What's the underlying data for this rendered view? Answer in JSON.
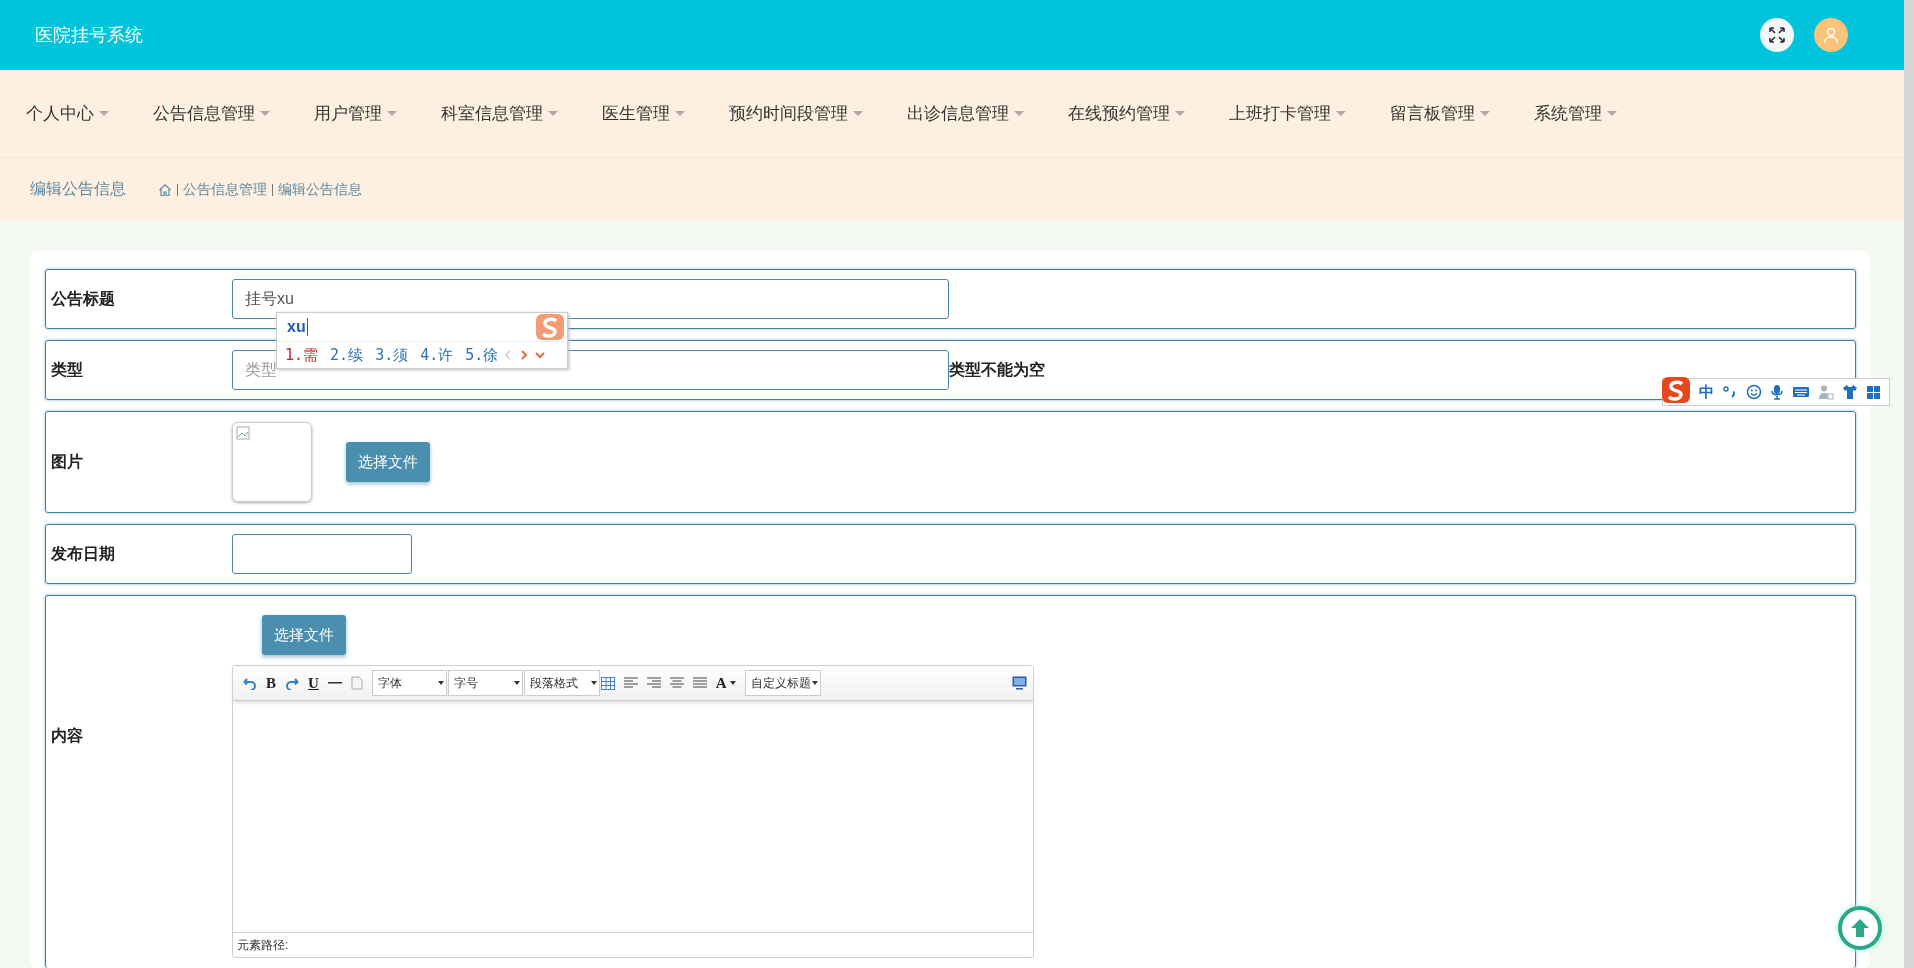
{
  "header": {
    "title": "医院挂号系统"
  },
  "nav": [
    {
      "label": "个人中心"
    },
    {
      "label": "公告信息管理"
    },
    {
      "label": "用户管理"
    },
    {
      "label": "科室信息管理"
    },
    {
      "label": "医生管理"
    },
    {
      "label": "预约时间段管理"
    },
    {
      "label": "出诊信息管理"
    },
    {
      "label": "在线预约管理"
    },
    {
      "label": "上班打卡管理"
    },
    {
      "label": "留言板管理"
    },
    {
      "label": "系统管理"
    }
  ],
  "breadcrumb": {
    "page_title": "编辑公告信息",
    "path": [
      "公告信息管理",
      "编辑公告信息"
    ]
  },
  "form": {
    "fields": [
      {
        "kind": "text",
        "label": "公告标题",
        "value": "挂号xu"
      },
      {
        "kind": "text",
        "label": "类型",
        "placeholder": "类型",
        "error": "类型不能为空"
      },
      {
        "kind": "image",
        "label": "图片",
        "button": "选择文件"
      },
      {
        "kind": "date",
        "label": "发布日期"
      },
      {
        "kind": "editor",
        "label": "内容",
        "button": "选择文件"
      }
    ]
  },
  "editor": {
    "bold": "B",
    "underline": "U",
    "font_color": "A",
    "selects": [
      "字体",
      "字号",
      "段落格式",
      "自定义标题"
    ],
    "status": "元素路径:"
  },
  "ime_popup": {
    "composition": "xu",
    "candidates": [
      {
        "label": "1.需",
        "selected": true
      },
      {
        "label": "2.续",
        "selected": false
      },
      {
        "label": "3.须",
        "selected": false
      },
      {
        "label": "4.许",
        "selected": false
      },
      {
        "label": "5.徐",
        "selected": false
      }
    ]
  },
  "ime_toolbar": {
    "mode": "中"
  }
}
